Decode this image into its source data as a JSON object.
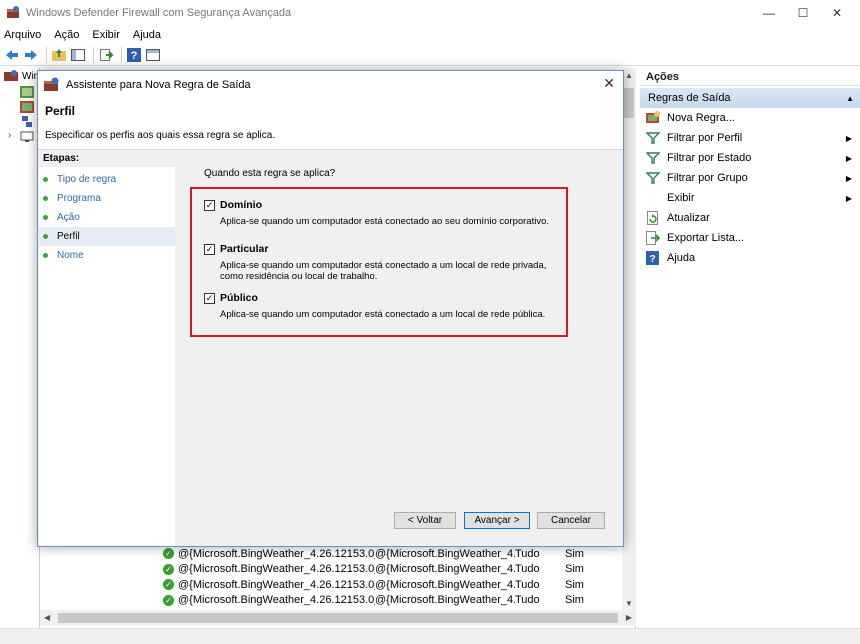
{
  "window": {
    "title": "Windows Defender Firewall com Segurança Avançada",
    "minimize": "—",
    "maximize": "☐",
    "close": "✕"
  },
  "menu": [
    "Arquivo",
    "Ação",
    "Exibir",
    "Ajuda"
  ],
  "tree": {
    "root_label_partial": "Win"
  },
  "list_rows": [
    {
      "name": "@{Microsoft.BingWeather_4.26.12153.0_x...",
      "group": "@{Microsoft.BingWeather_4...",
      "profile": "Tudo",
      "enabled": "Sim"
    },
    {
      "name": "@{Microsoft.BingWeather_4.26.12153.0_x...",
      "group": "@{Microsoft.BingWeather_4...",
      "profile": "Tudo",
      "enabled": "Sim"
    },
    {
      "name": "@{Microsoft.BingWeather_4.26.12153.0_x...",
      "group": "@{Microsoft.BingWeather_4...",
      "profile": "Tudo",
      "enabled": "Sim"
    },
    {
      "name": "@{Microsoft.BingWeather_4.26.12153.0_x...",
      "group": "@{Microsoft.BingWeather_4...",
      "profile": "Tudo",
      "enabled": "Sim"
    }
  ],
  "actions": {
    "header": "Ações",
    "section": "Regras de Saída",
    "items": [
      {
        "label": "Nova Regra...",
        "icon": "new-rule-icon"
      },
      {
        "label": "Filtrar por Perfil",
        "icon": "filter-icon",
        "submenu": true
      },
      {
        "label": "Filtrar por Estado",
        "icon": "filter-icon",
        "submenu": true
      },
      {
        "label": "Filtrar por Grupo",
        "icon": "filter-icon",
        "submenu": true
      },
      {
        "label": "Exibir",
        "icon": "",
        "submenu": true
      },
      {
        "label": "Atualizar",
        "icon": "refresh-icon"
      },
      {
        "label": "Exportar Lista...",
        "icon": "export-icon"
      },
      {
        "label": "Ajuda",
        "icon": "help-icon"
      }
    ]
  },
  "dialog": {
    "title": "Assistente para Nova Regra de Saída",
    "heading": "Perfil",
    "subheading": "Especificar os perfis aos quais essa regra se aplica.",
    "steps_header": "Etapas:",
    "steps": [
      "Tipo de regra",
      "Programa",
      "Ação",
      "Perfil",
      "Nome"
    ],
    "active_step": "Perfil",
    "question": "Quando esta regra se aplica?",
    "options": [
      {
        "label": "Domínio",
        "checked": true,
        "desc": "Aplica-se quando um computador está conectado ao seu domínio corporativo."
      },
      {
        "label": "Particular",
        "checked": true,
        "desc": "Aplica-se quando um computador está conectado a um local de rede privada, como residência ou local de trabalho."
      },
      {
        "label": "Público",
        "checked": true,
        "desc": "Aplica-se quando um computador está conectado a um local de rede pública."
      }
    ],
    "buttons": {
      "back": "< Voltar",
      "next": "Avançar >",
      "cancel": "Cancelar"
    }
  },
  "colors": {
    "highlight_border": "#d11c27",
    "link": "#2c67b5",
    "step_dot": "#37a63d"
  }
}
